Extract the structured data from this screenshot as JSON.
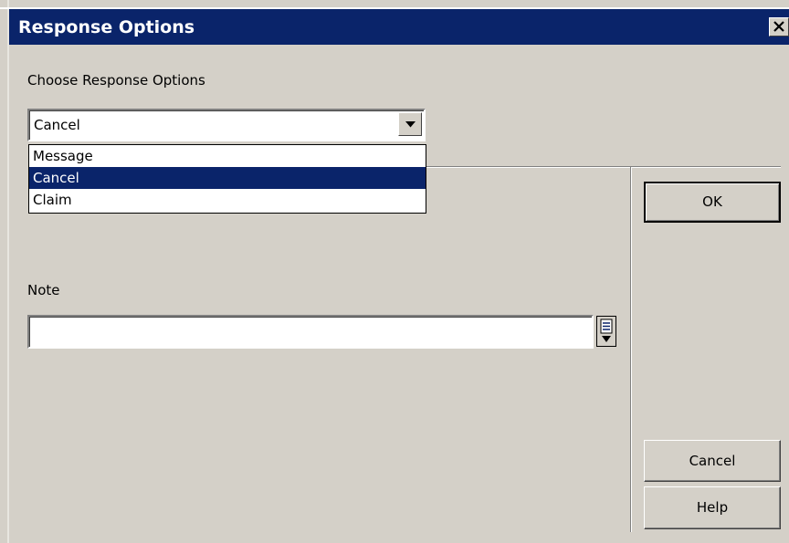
{
  "window": {
    "title": "Response Options"
  },
  "response": {
    "label": "Choose Response Options",
    "selected_value": "Cancel",
    "options": [
      "Message",
      "Cancel",
      "Claim"
    ],
    "highlighted_index": 1
  },
  "note": {
    "label": "Note",
    "value": ""
  },
  "buttons": {
    "ok": "OK",
    "cancel": "Cancel",
    "help": "Help"
  },
  "colors": {
    "titlebar": "#0a246a",
    "face": "#d4d0c8",
    "selection": "#0a246a"
  },
  "icons": {
    "close": "close-icon",
    "dropdown": "chevron-down-icon",
    "note_picker": "list-picker-icon"
  }
}
